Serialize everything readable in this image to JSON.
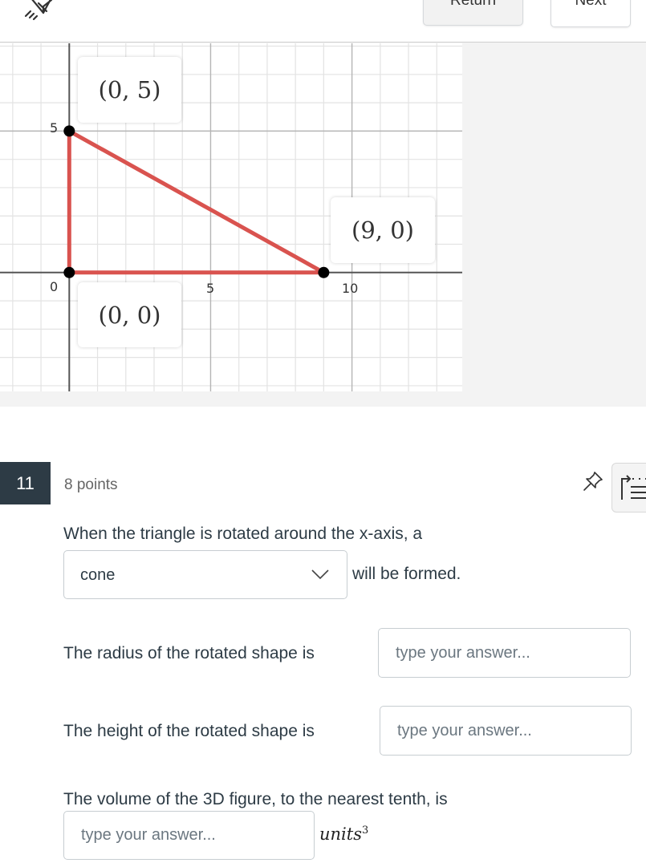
{
  "toolbar": {
    "marker_icon": "highlighter-icon",
    "return_label": "Return",
    "next_label": "Next"
  },
  "graph": {
    "tick_labels": {
      "x": [
        "0",
        "5",
        "10"
      ],
      "y": [
        "5"
      ]
    },
    "point_labels": [
      "(0, 5)",
      "(9, 0)",
      "(0, 0)"
    ],
    "triangle_color": "#d9534f",
    "point_color": "#000000",
    "grid_color": "#e3e3e3",
    "axis_color": "#555555"
  },
  "chart_data": {
    "type": "scatter",
    "title": "",
    "xlabel": "",
    "ylabel": "",
    "xlim": [
      -2.45,
      13.9
    ],
    "ylim": [
      -4.2,
      8.1
    ],
    "grid": true,
    "major_grid_step": 5,
    "minor_grid_step": 1,
    "x_ticks": [
      0,
      5,
      10
    ],
    "y_ticks": [
      5
    ],
    "points": [
      {
        "x": 0,
        "y": 5,
        "label": "(0, 5)"
      },
      {
        "x": 9,
        "y": 0,
        "label": "(9, 0)"
      },
      {
        "x": 0,
        "y": 0,
        "label": "(0, 0)"
      }
    ],
    "series": [
      {
        "name": "triangle",
        "type": "polygon",
        "x": [
          0,
          9,
          0
        ],
        "y": [
          0,
          0,
          5
        ],
        "color": "#d9534f"
      }
    ]
  },
  "question": {
    "number": "11",
    "points": "8 points",
    "pin_icon": "pin-icon",
    "list_icon": "question-list-icon",
    "line1": "When the triangle is rotated around the x-axis, a",
    "dropdown_value": "cone",
    "line2": "will be formed.",
    "radius_label": "The radius of the rotated shape is",
    "height_label": "The height of the rotated shape is",
    "volume_label": "The volume of the 3D figure, to the nearest tenth, is",
    "placeholder": "type your answer...",
    "units": "units",
    "units_exp": "3"
  }
}
